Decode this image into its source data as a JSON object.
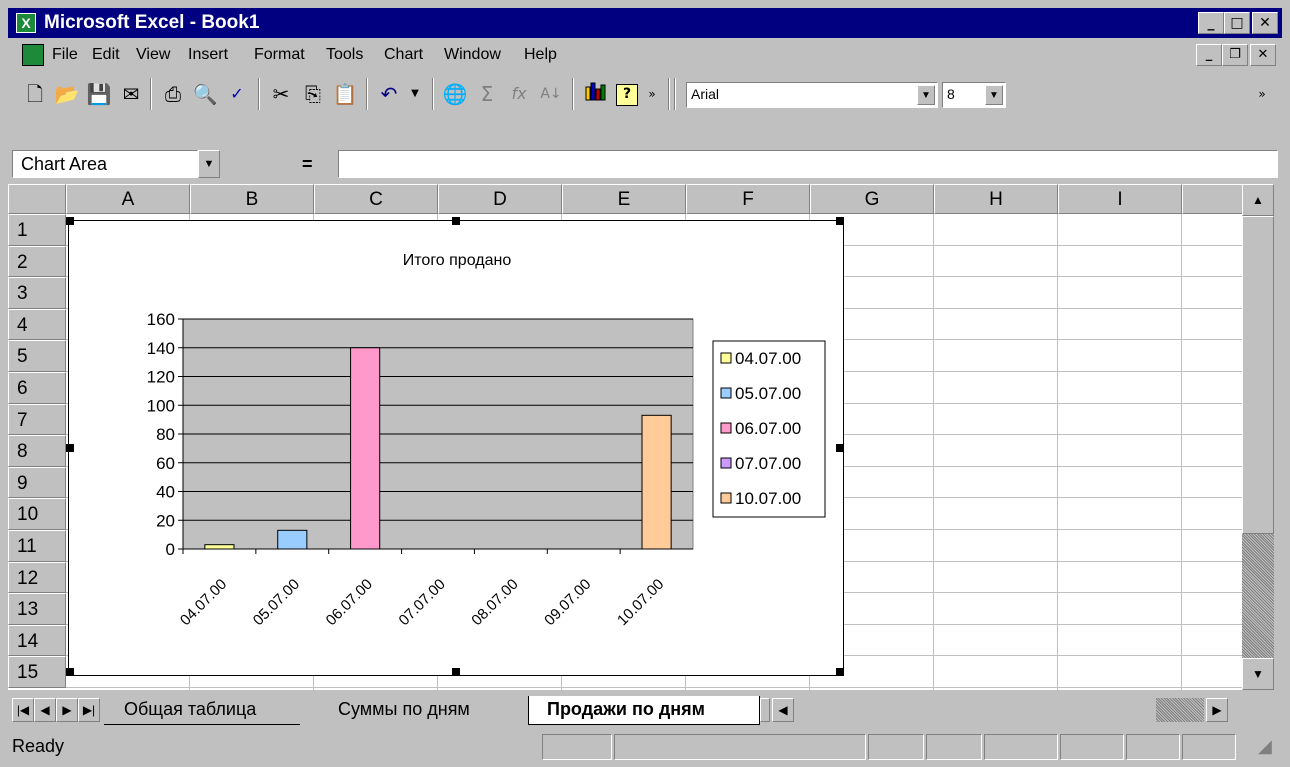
{
  "window": {
    "title": "Microsoft Excel - Book1"
  },
  "menu": {
    "items": [
      "File",
      "Edit",
      "View",
      "Insert",
      "Format",
      "Tools",
      "Chart",
      "Window",
      "Help"
    ]
  },
  "toolbar": {
    "font_name": "Arial",
    "font_size": "8"
  },
  "formula_bar": {
    "name_box": "Chart Area",
    "equals": "=",
    "formula": ""
  },
  "grid": {
    "columns": [
      "A",
      "B",
      "C",
      "D",
      "E",
      "F",
      "G",
      "H",
      "I"
    ],
    "rows": [
      "1",
      "2",
      "3",
      "4",
      "5",
      "6",
      "7",
      "8",
      "9",
      "10",
      "11",
      "12",
      "13",
      "14",
      "15"
    ]
  },
  "chart_data": {
    "type": "bar",
    "title": "Итого продано",
    "categories": [
      "04.07.00",
      "05.07.00",
      "06.07.00",
      "07.07.00",
      "08.07.00",
      "09.07.00",
      "10.07.00"
    ],
    "values": [
      3,
      13,
      140,
      0,
      0,
      0,
      93
    ],
    "bar_colors": [
      "#ffff99",
      "#99ccff",
      "#ff99cc",
      "#cc99ff",
      "#ffff99",
      "#99ccff",
      "#ffcc99"
    ],
    "ylim": [
      0,
      160
    ],
    "yticks": [
      "0",
      "20",
      "40",
      "60",
      "80",
      "100",
      "120",
      "140",
      "160"
    ],
    "plot_background": "#c0c0c0",
    "grid": true,
    "legend_position": "right",
    "legend": [
      {
        "name": "04.07.00",
        "color": "#ffff99"
      },
      {
        "name": "05.07.00",
        "color": "#99ccff"
      },
      {
        "name": "06.07.00",
        "color": "#ff99cc"
      },
      {
        "name": "07.07.00",
        "color": "#cc99ff"
      },
      {
        "name": "10.07.00",
        "color": "#ffcc99"
      }
    ]
  },
  "sheet_tabs": {
    "tabs": [
      "Общая таблица",
      "Суммы по дням",
      "Продажи по дням"
    ],
    "active": "Продажи по дням"
  },
  "status": {
    "text": "Ready"
  },
  "colors": {
    "titlebar": "#000080",
    "face": "#c0c0c0"
  }
}
